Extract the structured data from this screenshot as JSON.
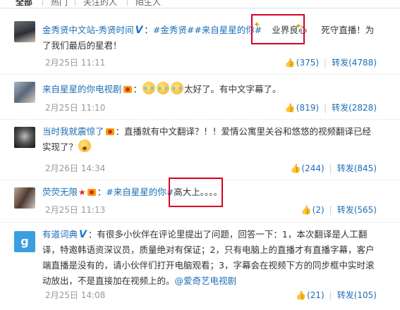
{
  "tabs": [
    "全部",
    "热门",
    "关注的人",
    "陌生人"
  ],
  "comments": [
    {
      "name": "金秀贤中文站-秀贤时间",
      "badge": "V",
      "text_links": "#金秀贤##来自星星的你#",
      "highlight": "业界良心",
      "text_after": "死守直播！为了我们最后的星君！",
      "time": "2月25日 11:11",
      "likes": "(375)",
      "repost": "转发(4788)"
    },
    {
      "name": "来自星星的你电视剧",
      "text_after": "太好了。有中文字幕了。",
      "time": "2月25日 11:10",
      "likes": "(819)",
      "repost": "转发(2828)"
    },
    {
      "name": "当时我就震惊了",
      "text": "：直播就有中文翻译？！！爱情公寓里关谷和悠悠的视频翻译已经实现了？",
      "time": "2月26日 14:34",
      "likes": "(244)",
      "repost": "转发(845)"
    },
    {
      "name": "荧荧无限",
      "link": "#来自星星的你#",
      "highlight": "高大上。。。。",
      "time": "2月25日 11:13",
      "likes": "(2)",
      "repost": "转发(565)"
    },
    {
      "name": "有道词典",
      "badge": "V",
      "text": "：有很多小伙伴在评论里提出了问题，回答一下：1，本次翻译是人工翻译，特邀韩语资深议员，质量绝对有保证；2，只有电脑上的直播才有直播字幕，客户端直播是没有的，请小伙伴们打开电脑观看；3，字幕会在视频下方的同步框中实时滚动放出，不是直接加在视频上的。",
      "link_tail": "@爱奇艺电视剧",
      "time": "2月25日 14:08",
      "likes": "(21)",
      "repost": "转发(105)"
    }
  ]
}
